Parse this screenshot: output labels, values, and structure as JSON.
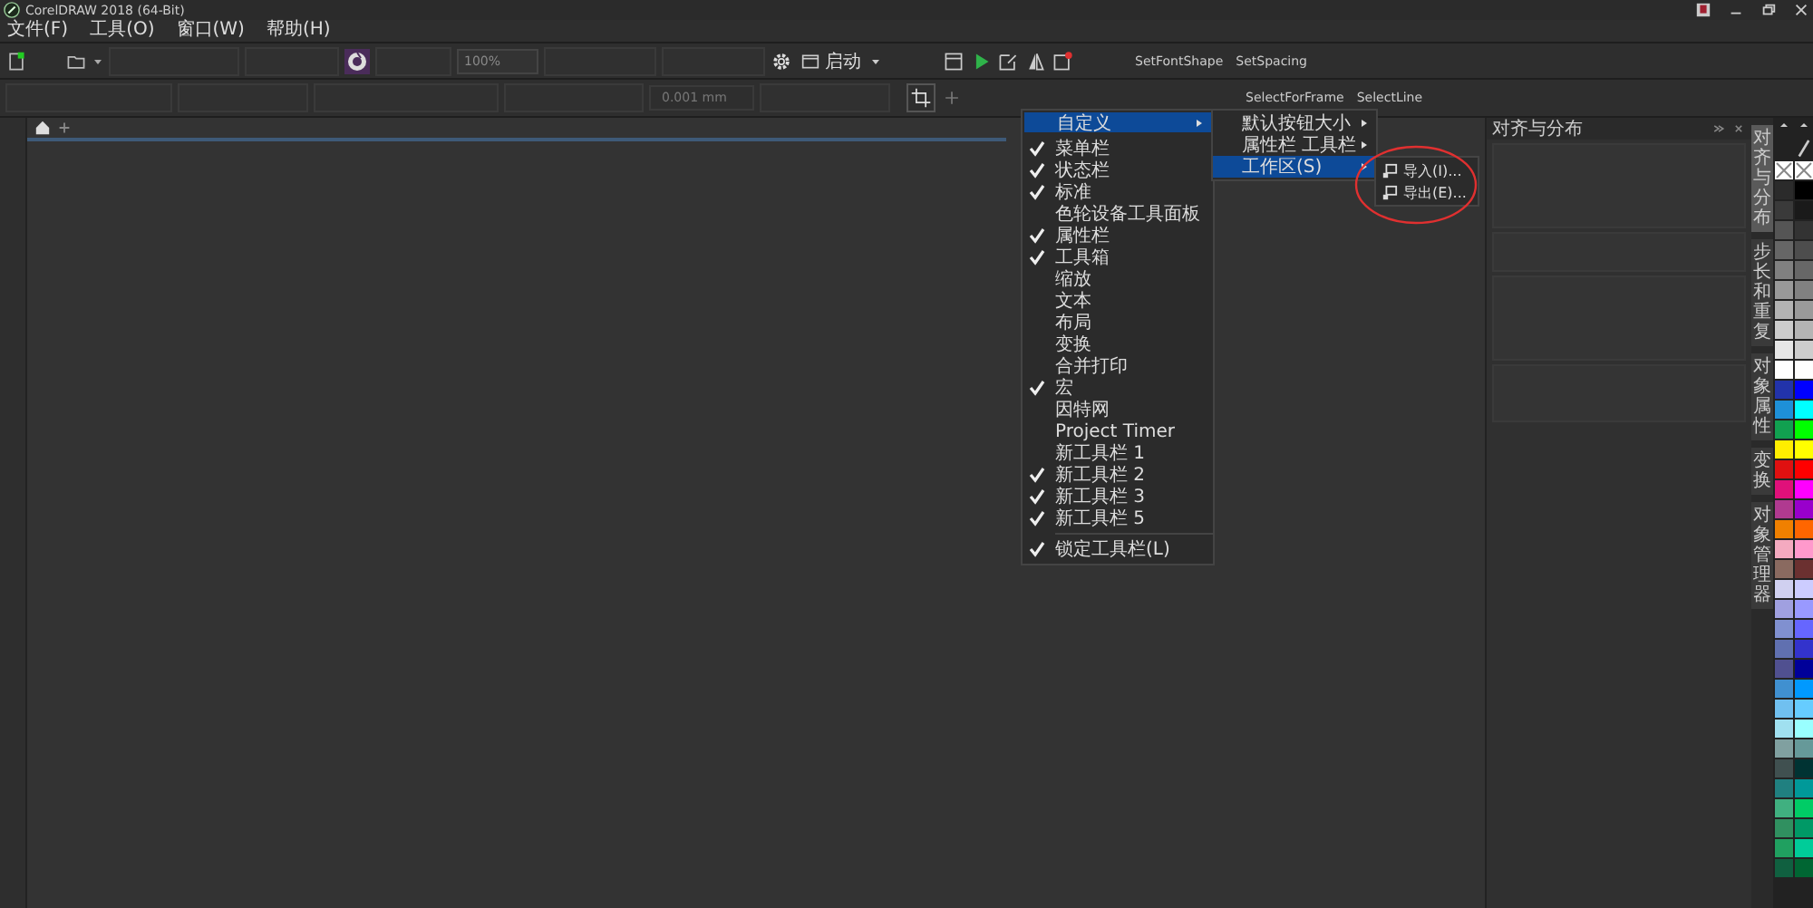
{
  "window": {
    "title": "CorelDRAW 2018 (64-Bit)"
  },
  "menubar": [
    "文件(F)",
    "工具(O)",
    "窗口(W)",
    "帮助(H)"
  ],
  "toolbar": {
    "zoom": "100%",
    "launch": "启动",
    "macros": [
      "SetFontShape",
      "SetSpacing"
    ]
  },
  "property_bar": {
    "nudge": "0.001 mm",
    "macros": [
      "SelectForFrame",
      "SelectLine"
    ]
  },
  "context_menu": {
    "header": {
      "label": "自定义",
      "selected": true
    },
    "items": [
      {
        "label": "菜单栏",
        "checked": true
      },
      {
        "label": "状态栏",
        "checked": true
      },
      {
        "label": "标准",
        "checked": true
      },
      {
        "label": "色轮设备工具面板",
        "checked": false
      },
      {
        "label": "属性栏",
        "checked": true
      },
      {
        "label": "工具箱",
        "checked": true
      },
      {
        "label": "缩放",
        "checked": false
      },
      {
        "label": "文本",
        "checked": false
      },
      {
        "label": "布局",
        "checked": false
      },
      {
        "label": "变换",
        "checked": false
      },
      {
        "label": "合并打印",
        "checked": false
      },
      {
        "label": "宏",
        "checked": true
      },
      {
        "label": "因特网",
        "checked": false
      },
      {
        "label": "Project Timer",
        "checked": false
      },
      {
        "label": "新工具栏 1",
        "checked": false
      },
      {
        "label": "新工具栏 2",
        "checked": true
      },
      {
        "label": "新工具栏 3",
        "checked": true
      },
      {
        "label": "新工具栏 5",
        "checked": true
      }
    ],
    "footer": {
      "label": "锁定工具栏(L)",
      "checked": true
    }
  },
  "submenu": [
    {
      "label": "默认按钮大小",
      "selected": false
    },
    {
      "label": "属性栏 工具栏",
      "selected": false
    },
    {
      "label": "工作区(S)",
      "selected": true
    }
  ],
  "workspace_submenu": [
    "导入(I)...",
    "导出(E)..."
  ],
  "docker": {
    "title": "对齐与分布"
  },
  "docker_tabs": [
    {
      "label": "对齐与分布",
      "selected": true
    },
    {
      "label": "步长和重复",
      "selected": false
    },
    {
      "label": "对象属性",
      "selected": false
    },
    {
      "label": "变换",
      "selected": false
    },
    {
      "label": "对象管理器",
      "selected": false
    }
  ],
  "palette": [
    {
      "color": "#2b2b2b"
    },
    {
      "color": "#000000"
    },
    {
      "color": "#3a3a3a"
    },
    {
      "color": "#1a1a1a"
    },
    {
      "color": "#555555"
    },
    {
      "color": "#333333"
    },
    {
      "color": "#666666"
    },
    {
      "color": "#4d4d4d"
    },
    {
      "color": "#808080"
    },
    {
      "color": "#676767"
    },
    {
      "color": "#999999"
    },
    {
      "color": "#818181"
    },
    {
      "color": "#b3b3b3"
    },
    {
      "color": "#9a9a9a"
    },
    {
      "color": "#cccccc"
    },
    {
      "color": "#b4b4b4"
    },
    {
      "color": "#e6e6e6"
    },
    {
      "color": "#cdcdcd"
    },
    {
      "color": "#ffffff"
    },
    {
      "color": "#fefefe"
    },
    {
      "color": "#2233aa"
    },
    {
      "color": "#0000ff"
    },
    {
      "color": "#1e90d8"
    },
    {
      "color": "#00ffff"
    },
    {
      "color": "#11a050"
    },
    {
      "color": "#00ff00"
    },
    {
      "color": "#ffee00"
    },
    {
      "color": "#ffff00"
    },
    {
      "color": "#e01010"
    },
    {
      "color": "#ff0000"
    },
    {
      "color": "#e0107a"
    },
    {
      "color": "#ff00ff"
    },
    {
      "color": "#b03a90"
    },
    {
      "color": "#9900cc"
    },
    {
      "color": "#f08000"
    },
    {
      "color": "#ff6600"
    },
    {
      "color": "#f4aac0"
    },
    {
      "color": "#ff99cc"
    },
    {
      "color": "#8a6a60"
    },
    {
      "color": "#6b3030"
    },
    {
      "color": "#d0d0f0"
    },
    {
      "color": "#ccccff"
    },
    {
      "color": "#a0a0e0"
    },
    {
      "color": "#9999ff"
    },
    {
      "color": "#8090d0"
    },
    {
      "color": "#6666ff"
    },
    {
      "color": "#6070b0"
    },
    {
      "color": "#3333cc"
    },
    {
      "color": "#505090"
    },
    {
      "color": "#000099"
    },
    {
      "color": "#4090d0"
    },
    {
      "color": "#0099ff"
    },
    {
      "color": "#70c0f0"
    },
    {
      "color": "#66ccff"
    },
    {
      "color": "#a0e0f0"
    },
    {
      "color": "#99ffff"
    },
    {
      "color": "#80a0a0"
    },
    {
      "color": "#669999"
    },
    {
      "color": "#405050"
    },
    {
      "color": "#003333"
    },
    {
      "color": "#208080"
    },
    {
      "color": "#009999"
    },
    {
      "color": "#40b080"
    },
    {
      "color": "#00cc66"
    },
    {
      "color": "#309060"
    },
    {
      "color": "#009966"
    },
    {
      "color": "#20a060"
    },
    {
      "color": "#00cc99"
    },
    {
      "color": "#106040"
    },
    {
      "color": "#006633"
    }
  ]
}
